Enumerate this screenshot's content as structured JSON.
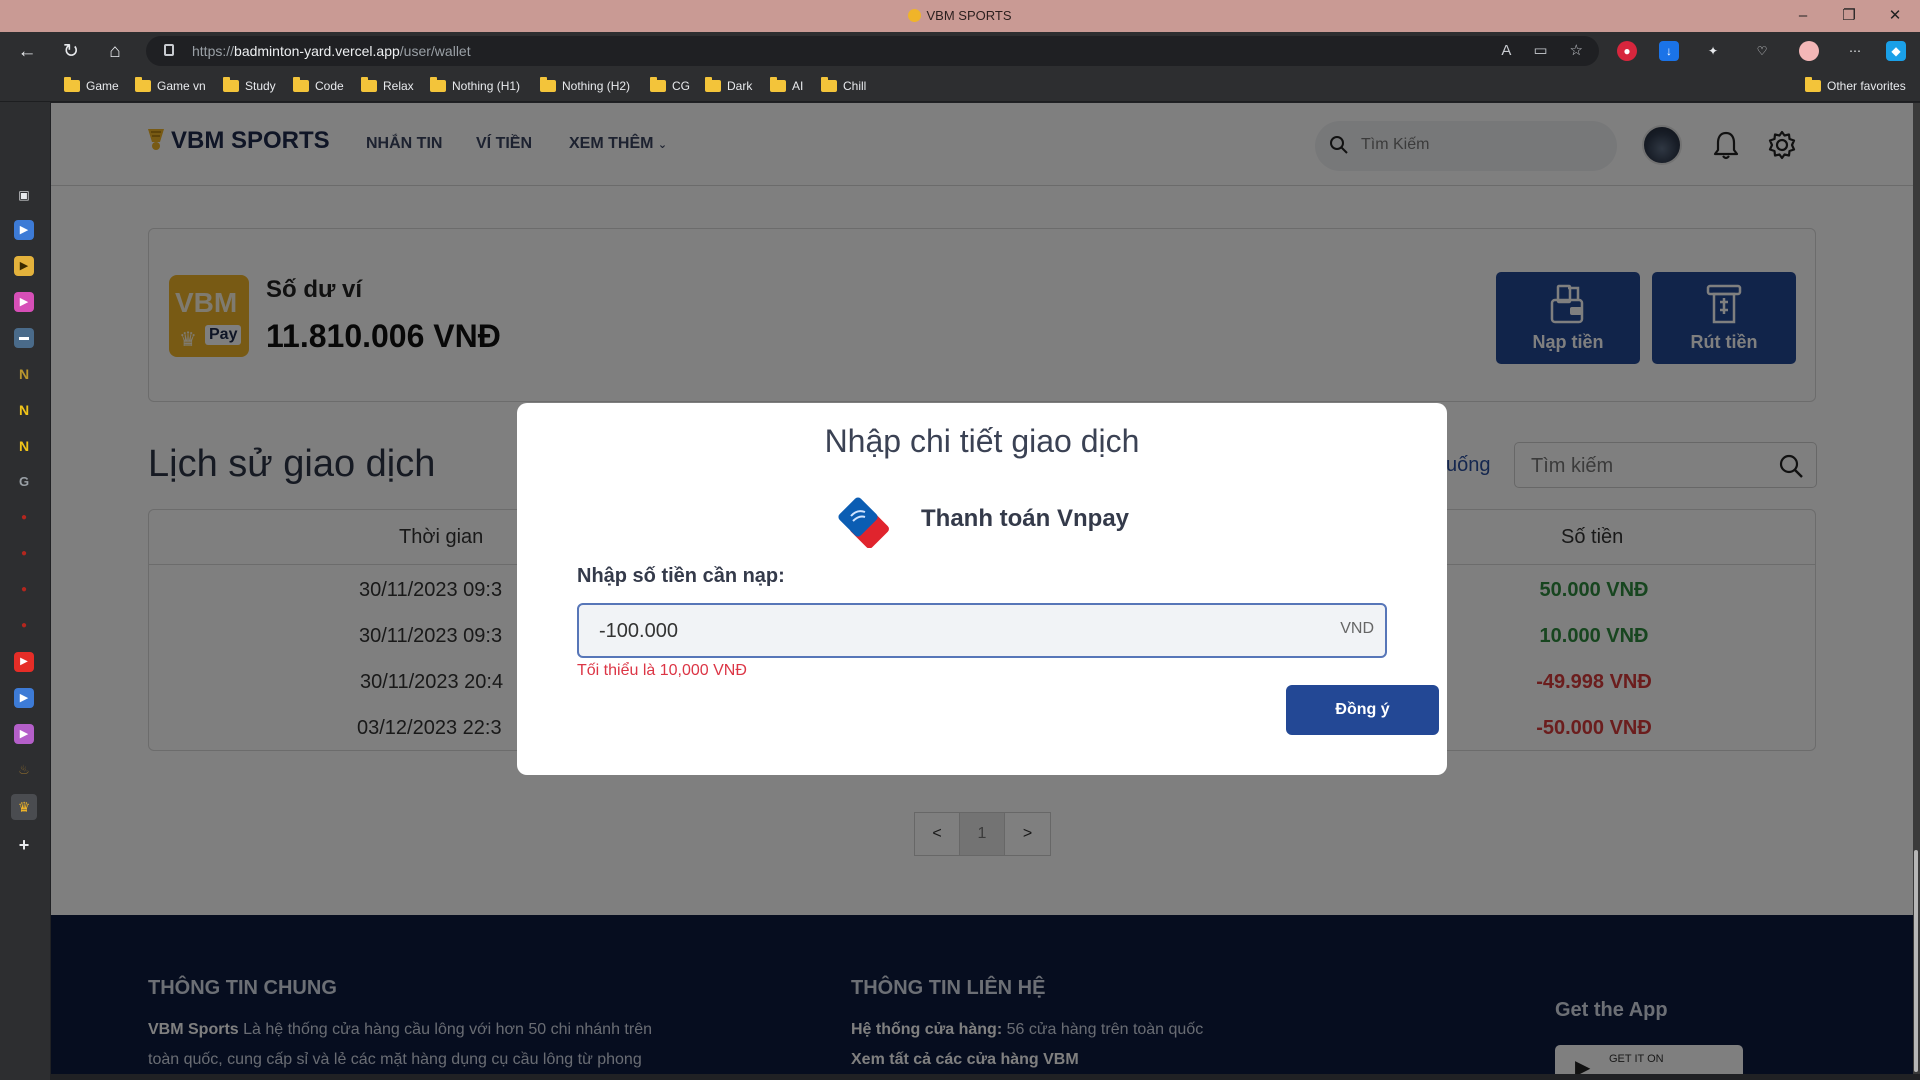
{
  "browser": {
    "window_title": "VBM SPORTS",
    "url_scheme": "https://",
    "url_host": "badminton-yard.vercel.app",
    "url_path": "/user/wallet",
    "favorites": [
      "Game",
      "Game vn",
      "Study",
      "Code",
      "Relax",
      "Nothing (H1)",
      "Nothing (H2)",
      "CG",
      "Dark",
      "AI",
      "Chill"
    ],
    "other_favorites": "Other favorites"
  },
  "site": {
    "brand": "VBM SPORTS",
    "nav": [
      "NHẮN TIN",
      "VÍ TIỀN",
      "XEM THÊM"
    ],
    "search_placeholder": "Tìm Kiếm"
  },
  "wallet": {
    "logo_text": "VBM",
    "logo_sub": "Pay",
    "balance_label": "Số dư ví",
    "balance_value": "11.810.006 VNĐ",
    "deposit_label": "Nạp tiền",
    "withdraw_label": "Rút tiền"
  },
  "history": {
    "title": "Lịch sử giao dịch",
    "sort_link": "xuống",
    "search_placeholder": "Tìm kiếm",
    "col_time": "Thời gian",
    "col_amount": "Số tiền",
    "rows": [
      {
        "time": "30/11/2023 09:3",
        "amount": "50.000 VNĐ",
        "amount_color": "#2e8b3e"
      },
      {
        "time": "30/11/2023 09:3",
        "amount": "10.000 VNĐ",
        "amount_color": "#2e8b3e"
      },
      {
        "time": "30/11/2023 20:4",
        "amount": "-49.998 VNĐ",
        "amount_color": "#d63a3a"
      },
      {
        "time": "03/12/2023 22:3",
        "amount": "-50.000 VNĐ",
        "amount_color": "#d63a3a"
      }
    ]
  },
  "pagination": {
    "prev": "<",
    "current": "1",
    "next": ">"
  },
  "footer": {
    "general_title": "THÔNG TIN CHUNG",
    "general_brand": "VBM Sports",
    "general_text_1": " Là hệ thống cửa hàng cầu lông với hơn 50 chi nhánh trên",
    "general_text_2": "toàn quốc, cung cấp sỉ và lẻ các mặt hàng dụng cụ cầu lông từ phong",
    "contact_title": "THÔNG TIN LIÊN HỆ",
    "contact_stores_label": "Hệ thống cửa hàng:",
    "contact_stores_value": " 56 cửa hàng trên toàn quốc",
    "contact_more": "Xem tất cả các cửa hàng VBM",
    "getapp_title": "Get the App",
    "getapp_badge": "GET IT ON"
  },
  "modal": {
    "title": "Nhập chi tiết giao dịch",
    "method": "Thanh toán Vnpay",
    "amount_label": "Nhập số tiền cần nạp:",
    "amount_value": "-100.000",
    "amount_unit": "VND",
    "error": "Tối thiểu là 10,000 VNĐ",
    "confirm": "Đồng ý"
  },
  "colors": {
    "primary": "#234895",
    "brand_gold": "#f0b429",
    "positive": "#2e8b3e",
    "negative": "#d63a3a",
    "footer_bg": "#0d1b3f"
  }
}
